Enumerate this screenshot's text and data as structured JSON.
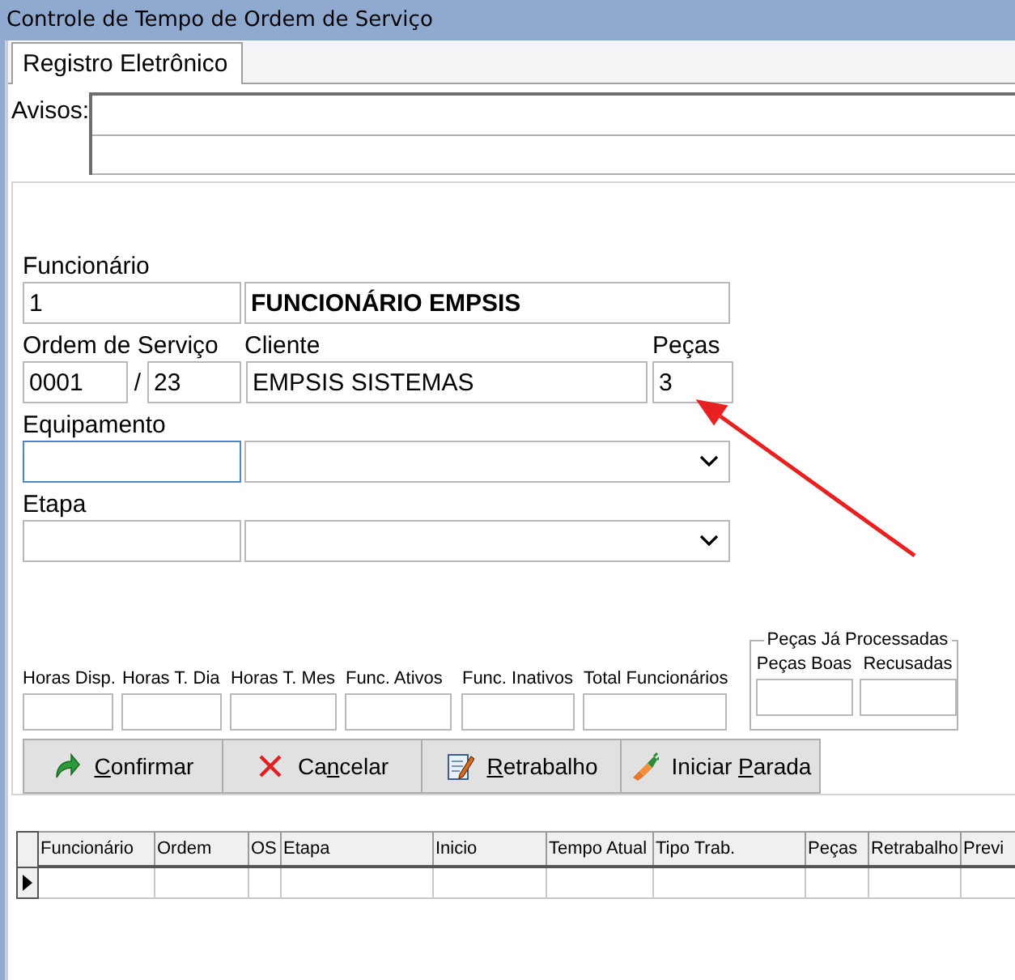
{
  "window": {
    "title": "Controle de Tempo de Ordem de Serviço"
  },
  "tabs": [
    {
      "label": "Registro Eletrônico",
      "selected": true
    }
  ],
  "notices": {
    "label": "Avisos:"
  },
  "form": {
    "employee": {
      "label": "Funcionário",
      "code": "1",
      "name": "FUNCIONÁRIO EMPSIS"
    },
    "order": {
      "label": "Ordem de Serviço",
      "number": "0001",
      "separator": "/",
      "year": "23"
    },
    "client": {
      "label": "Cliente",
      "value": "EMPSIS SISTEMAS"
    },
    "pieces": {
      "label": "Peças",
      "value": "3"
    },
    "equipment": {
      "label": "Equipamento",
      "focused": true
    },
    "stage": {
      "label": "Etapa",
      "focused": false
    }
  },
  "stats": [
    {
      "label": "Horas Disp."
    },
    {
      "label": "Horas T. Dia"
    },
    {
      "label": "Horas T. Mes"
    },
    {
      "label": "Func. Ativos"
    },
    {
      "label": "Func. Inativos"
    },
    {
      "label": "Total Funcionários"
    }
  ],
  "processed": {
    "title": "Peças Já Processadas",
    "fields": [
      {
        "label": "Peças Boas"
      },
      {
        "label": "Recusadas"
      }
    ]
  },
  "buttons": [
    {
      "kind": "confirm",
      "parts": [
        {
          "text": "C",
          "underlined": true
        },
        {
          "text": "onfirmar",
          "underlined": false
        }
      ]
    },
    {
      "kind": "cancel",
      "parts": [
        {
          "text": "Ca",
          "underlined": false
        },
        {
          "text": "n",
          "underlined": true
        },
        {
          "text": "celar",
          "underlined": false
        }
      ]
    },
    {
      "kind": "rework",
      "parts": [
        {
          "text": "R",
          "underlined": true
        },
        {
          "text": "etrabalho",
          "underlined": false
        }
      ]
    },
    {
      "kind": "stop",
      "parts": [
        {
          "text": "Iniciar ",
          "underlined": false
        },
        {
          "text": "P",
          "underlined": true
        },
        {
          "text": "arada",
          "underlined": false
        }
      ]
    }
  ],
  "grid": {
    "columns": [
      "Funcionário",
      "Ordem",
      "OS",
      "Etapa",
      "Inicio",
      "Tempo Atual",
      "Tipo Trab.",
      "Peças",
      "Retrabalho",
      "Previ"
    ],
    "rows": [
      {
        "current": true
      }
    ]
  }
}
